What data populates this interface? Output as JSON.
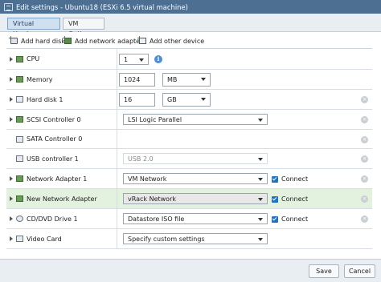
{
  "window": {
    "title": "Edit settings - Ubuntu18 (ESXi 6.5 virtual machine)"
  },
  "tabs": [
    {
      "label": "Virtual Hardware",
      "active": true
    },
    {
      "label": "VM Options",
      "active": false
    }
  ],
  "toolbar": {
    "add_hard_disk": "Add hard disk",
    "add_network_adapter": "Add network adapter",
    "add_other_device": "Add other device"
  },
  "devices": {
    "cpu": {
      "label": "CPU",
      "value": "1"
    },
    "memory": {
      "label": "Memory",
      "value": "1024",
      "unit": "MB"
    },
    "hard_disk": {
      "label": "Hard disk 1",
      "value": "16",
      "unit": "GB"
    },
    "scsi": {
      "label": "SCSI Controller 0",
      "value": "LSI Logic Parallel"
    },
    "sata": {
      "label": "SATA Controller 0"
    },
    "usb": {
      "label": "USB controller 1",
      "value": "USB 2.0"
    },
    "net1": {
      "label": "Network Adapter 1",
      "value": "VM Network",
      "connect": "Connect"
    },
    "net_new": {
      "label": "New Network Adapter",
      "value": "vRack Network",
      "connect": "Connect"
    },
    "cd": {
      "label": "CD/DVD Drive 1",
      "value": "Datastore ISO file",
      "connect": "Connect"
    },
    "video": {
      "label": "Video Card",
      "value": "Specify custom settings"
    }
  },
  "footer": {
    "save": "Save",
    "cancel": "Cancel"
  },
  "colors": {
    "titlebar": "#4d6f92",
    "highlight_row": "#e3f2df",
    "checkbox": "#1f73c7"
  }
}
